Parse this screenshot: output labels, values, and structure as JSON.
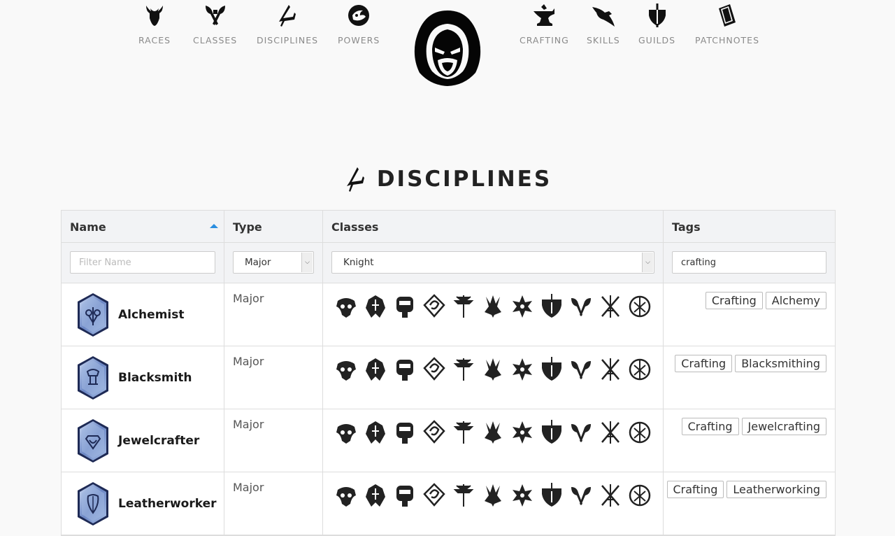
{
  "nav": {
    "left": [
      {
        "label": "RACES",
        "icon": "goat-icon"
      },
      {
        "label": "CLASSES",
        "icon": "crossed-axes-icon"
      },
      {
        "label": "DISCIPLINES",
        "icon": "disciplines-rune-icon"
      },
      {
        "label": "POWERS",
        "icon": "powers-emblem-icon"
      }
    ],
    "logo": "hooded-figure-logo",
    "right": [
      {
        "label": "CRAFTING",
        "icon": "anvil-icon"
      },
      {
        "label": "SKILLS",
        "icon": "raven-icon"
      },
      {
        "label": "GUILDS",
        "icon": "shield-sword-icon"
      },
      {
        "label": "PATCHNOTES",
        "icon": "cards-icon"
      }
    ]
  },
  "page": {
    "title": "DISCIPLINES",
    "title_icon": "disciplines-rune-icon"
  },
  "table": {
    "headers": {
      "name": "Name",
      "type": "Type",
      "classes": "Classes",
      "tags": "Tags"
    },
    "sort": {
      "column": "Name",
      "direction": "ascending"
    },
    "filters": {
      "name_placeholder": "Filter Name",
      "name_value": "",
      "type_value": "Major",
      "classes_value": "Knight",
      "tags_value": "crafting"
    },
    "rows": [
      {
        "name": "Alchemist",
        "type": "Major",
        "tags": [
          "Crafting",
          "Alchemy"
        ]
      },
      {
        "name": "Blacksmith",
        "type": "Major",
        "tags": [
          "Crafting",
          "Blacksmithing"
        ]
      },
      {
        "name": "Jewelcrafter",
        "type": "Major",
        "tags": [
          "Crafting",
          "Jewelcrafting"
        ]
      },
      {
        "name": "Leatherworker",
        "type": "Major",
        "tags": [
          "Crafting",
          "Leatherworking"
        ]
      }
    ],
    "class_icons": [
      "skull-class-icon",
      "helm-class-icon",
      "tiki-class-icon",
      "spiral-class-icon",
      "staff-class-icon",
      "horns-class-icon",
      "star-class-icon",
      "shield-class-icon",
      "axes-class-icon",
      "crossed-spears-class-icon",
      "circle-rune-class-icon"
    ]
  },
  "colors": {
    "background": "#f9f9f9",
    "sort_arrow": "#2a8ee0",
    "header_bg": "#f2f3f5",
    "gem_blue": "#6b86c4"
  }
}
